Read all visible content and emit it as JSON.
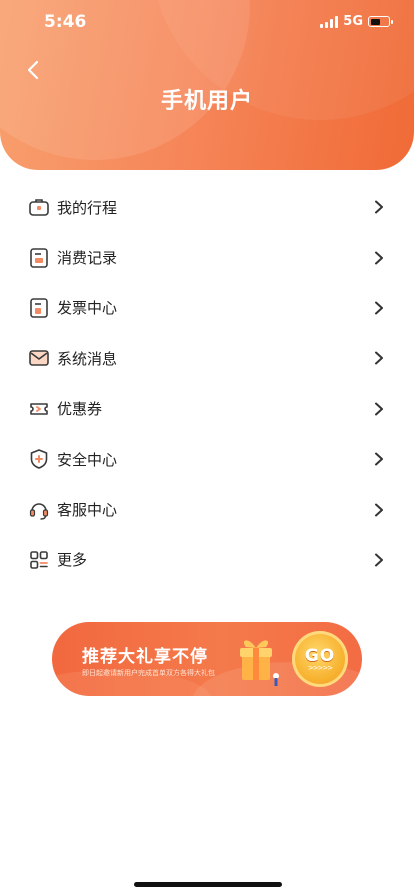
{
  "status_bar": {
    "time": "5:46",
    "network": "5G"
  },
  "header": {
    "title": "手机用户"
  },
  "menu": {
    "items": [
      {
        "label": "我的行程",
        "icon": "briefcase-icon"
      },
      {
        "label": "消费记录",
        "icon": "receipt-icon"
      },
      {
        "label": "发票中心",
        "icon": "invoice-icon"
      },
      {
        "label": "系统消息",
        "icon": "envelope-icon"
      },
      {
        "label": "优惠券",
        "icon": "coupon-icon"
      },
      {
        "label": "安全中心",
        "icon": "shield-icon"
      },
      {
        "label": "客服中心",
        "icon": "headset-icon"
      },
      {
        "label": "更多",
        "icon": "grid-icon"
      }
    ]
  },
  "banner": {
    "title": "推荐大礼享不停",
    "subtitle": "即日起邀请新用户完成首单双方各得大礼包",
    "button_label": "GO",
    "button_arrows": ">>>>>"
  },
  "colors": {
    "header_start": "#f8a06e",
    "header_end": "#f06a36",
    "icon_stroke": "#3a3a3a",
    "icon_accent": "#f28a63"
  }
}
